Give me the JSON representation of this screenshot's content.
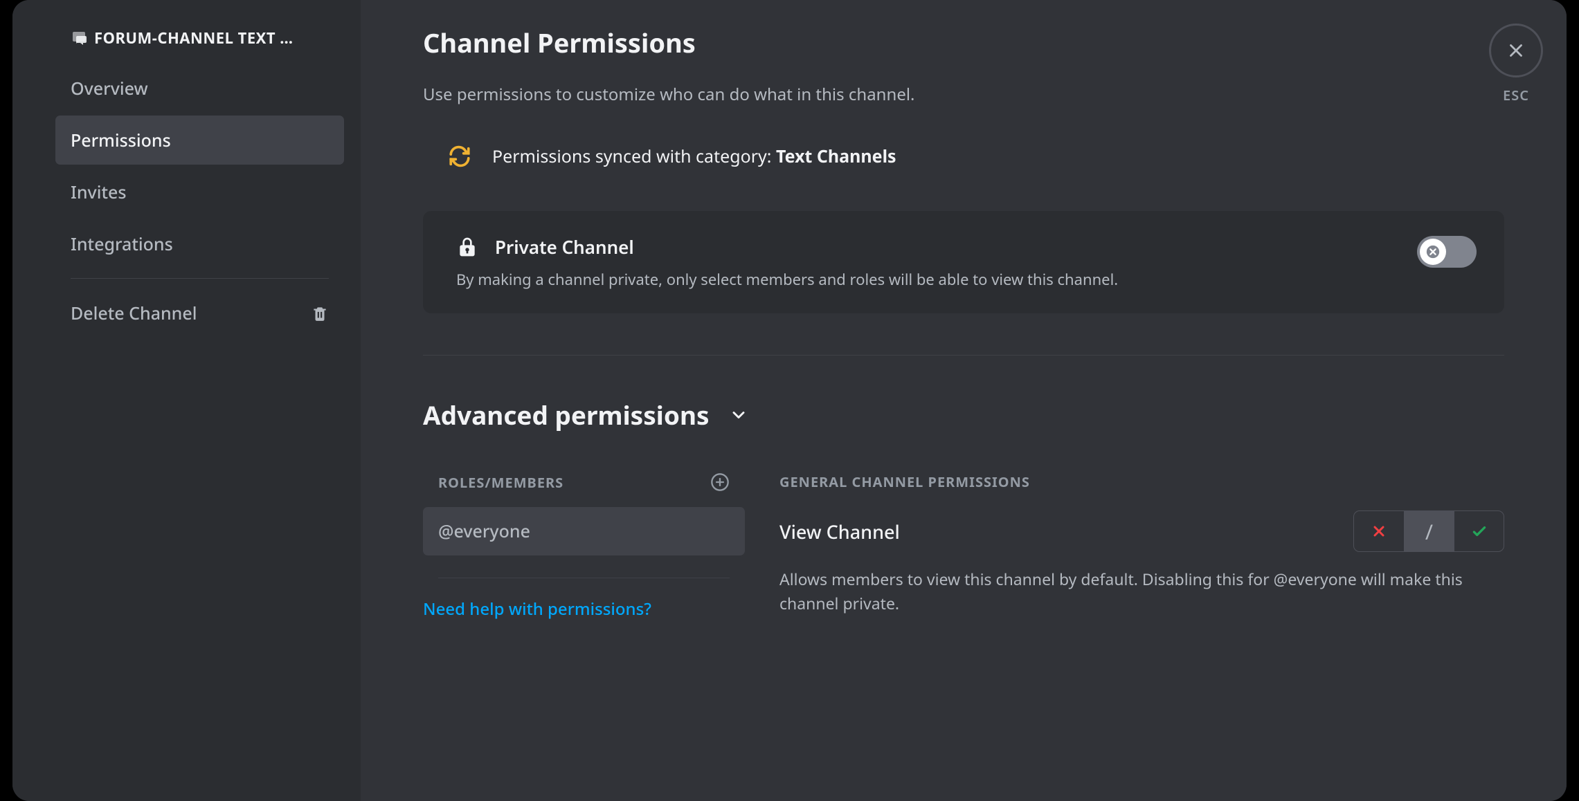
{
  "sidebar": {
    "header": "FORUM-CHANNEL TEXT …",
    "items": [
      {
        "label": "Overview"
      },
      {
        "label": "Permissions",
        "selected": true
      },
      {
        "label": "Invites"
      },
      {
        "label": "Integrations"
      }
    ],
    "delete_label": "Delete Channel"
  },
  "close": {
    "esc": "ESC"
  },
  "page": {
    "title": "Channel Permissions",
    "subtitle": "Use permissions to customize who can do what in this channel.",
    "sync_prefix": "Permissions synced with category: ",
    "sync_category": "Text Channels"
  },
  "private_card": {
    "title": "Private Channel",
    "desc": "By making a channel private, only select members and roles will be able to view this channel.",
    "enabled": false
  },
  "advanced": {
    "title": "Advanced permissions",
    "roles_label": "ROLES/MEMBERS",
    "roles": [
      {
        "name": "@everyone",
        "selected": true
      }
    ],
    "help_link": "Need help with permissions?",
    "right_label": "GENERAL CHANNEL PERMISSIONS",
    "permissions": [
      {
        "name": "View Channel",
        "desc": "Allows members to view this channel by default. Disabling this for @everyone will make this channel private.",
        "state": "neutral"
      }
    ],
    "neutral_glyph": "/"
  }
}
